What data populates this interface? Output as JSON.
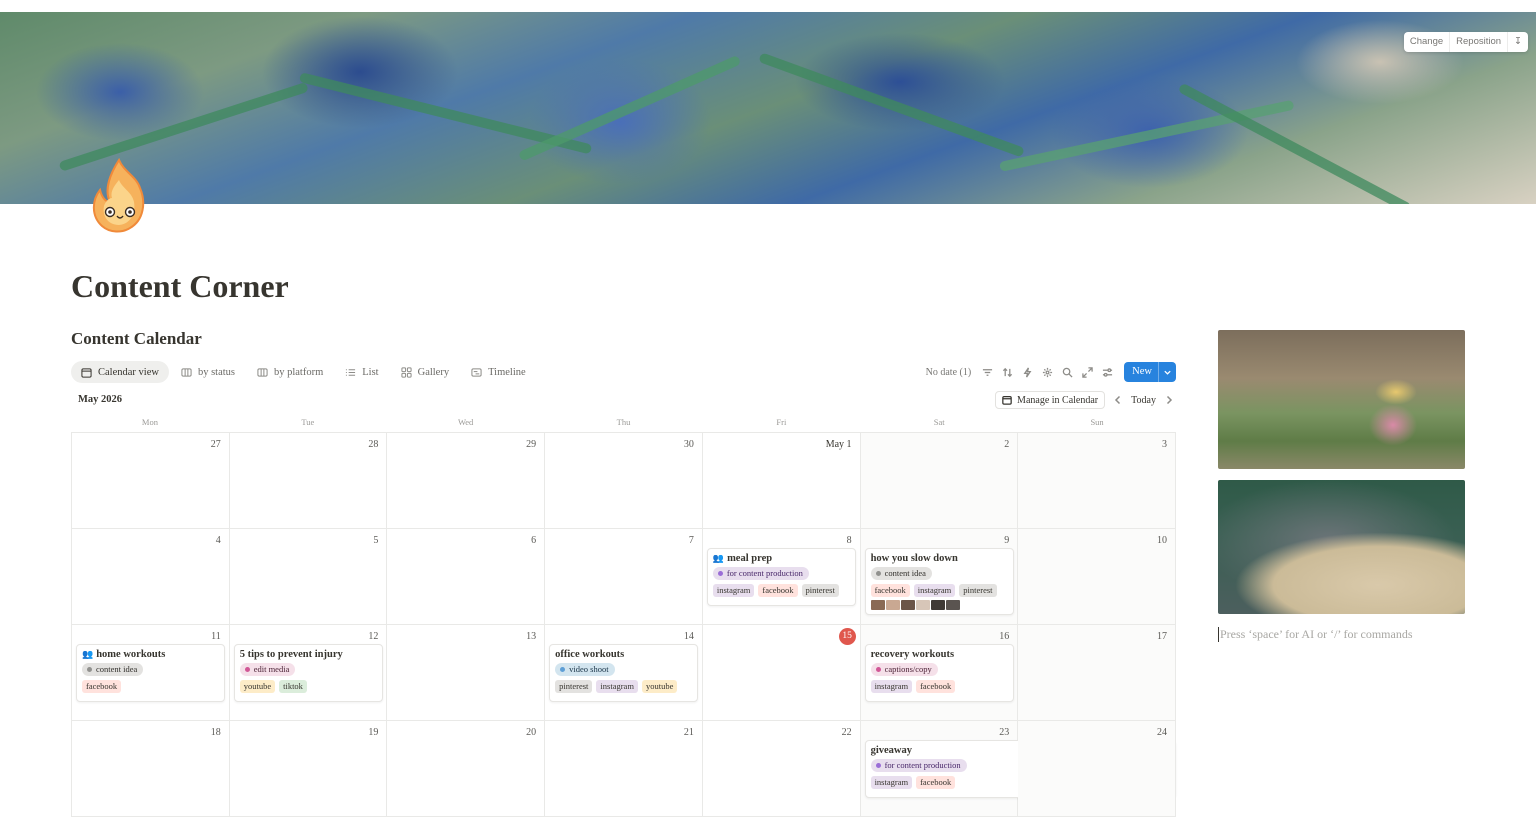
{
  "cover": {
    "change_label": "Change",
    "reposition_label": "Reposition"
  },
  "page": {
    "title": "Content Corner",
    "database_title": "Content Calendar"
  },
  "views": [
    {
      "label": "Calendar view",
      "icon": "calendar-icon",
      "active": true
    },
    {
      "label": "by status",
      "icon": "board-icon",
      "active": false
    },
    {
      "label": "by platform",
      "icon": "board-icon",
      "active": false
    },
    {
      "label": "List",
      "icon": "list-icon",
      "active": false
    },
    {
      "label": "Gallery",
      "icon": "gallery-icon",
      "active": false
    },
    {
      "label": "Timeline",
      "icon": "timeline-icon",
      "active": false
    }
  ],
  "toolbar": {
    "no_date_label": "No date (1)",
    "new_label": "New"
  },
  "calendar": {
    "month_label": "May 2026",
    "manage_label": "Manage in Calendar",
    "today_label": "Today",
    "weekdays": [
      "Mon",
      "Tue",
      "Wed",
      "Thu",
      "Fri",
      "Sat",
      "Sun"
    ],
    "weeks": [
      [
        "27",
        "28",
        "29",
        "30",
        "May 1",
        "2",
        "3"
      ],
      [
        "4",
        "5",
        "6",
        "7",
        "8",
        "9",
        "10"
      ],
      [
        "11",
        "12",
        "13",
        "14",
        "15",
        "16",
        "17"
      ],
      [
        "18",
        "19",
        "20",
        "21",
        "22",
        "23",
        "24"
      ]
    ],
    "today_date": "15"
  },
  "events": [
    {
      "title": "meal prep",
      "icon": "people-icon",
      "status": "for content production",
      "status_color": "purple",
      "platforms": [
        "instagram",
        "facebook",
        "pinterest"
      ]
    },
    {
      "title": "how you slow down",
      "status": "content idea",
      "status_color": "gray",
      "platforms": [
        "facebook",
        "instagram",
        "pinterest"
      ]
    },
    {
      "title": "home workouts",
      "icon": "people-icon",
      "status": "content idea",
      "status_color": "gray",
      "platforms": [
        "facebook"
      ]
    },
    {
      "title": "5 tips to prevent injury",
      "status": "edit media",
      "status_color": "pink",
      "platforms": [
        "youtube",
        "tiktok"
      ]
    },
    {
      "title": "office workouts",
      "status": "video shoot",
      "status_color": "blue",
      "platforms": [
        "pinterest",
        "instagram",
        "youtube"
      ]
    },
    {
      "title": "recovery workouts",
      "status": "captions/copy",
      "status_color": "pink",
      "platforms": [
        "instagram",
        "facebook"
      ]
    },
    {
      "title": "giveaway",
      "status": "for content production",
      "status_color": "purple",
      "platforms": [
        "instagram",
        "facebook"
      ]
    }
  ],
  "editor": {
    "placeholder": "Press ‘space’ for AI or ‘/’ for commands"
  },
  "colors": {
    "accent": "#2783de",
    "today_badge": "#e0574d",
    "tag_instagram": "#e8deee",
    "tag_facebook": "#ffe2dd",
    "tag_pinterest": "#e3e2e0",
    "tag_youtube": "#fdecc8",
    "tag_tiktok": "#dbeddb"
  }
}
